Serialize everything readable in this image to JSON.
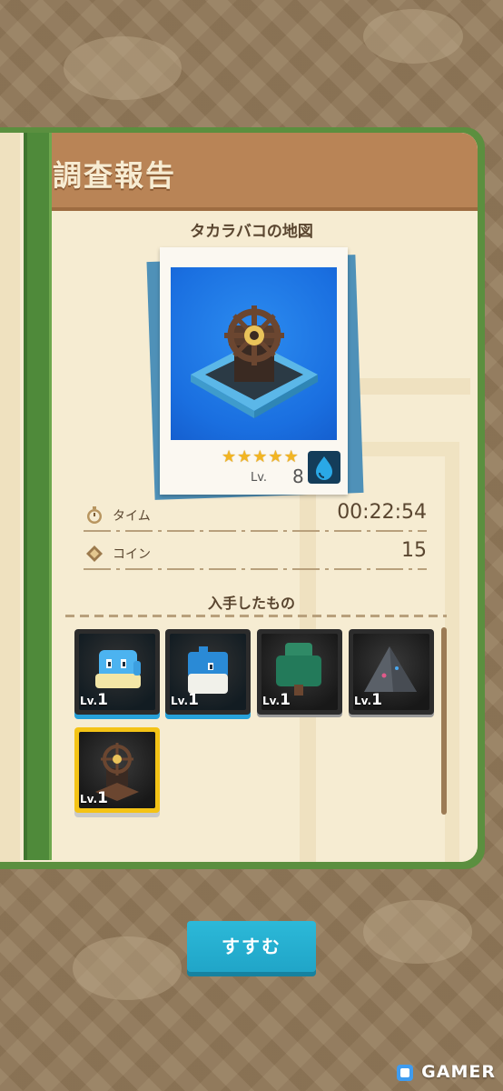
{
  "report": {
    "title": "調査報告",
    "map_name": "タカラバコの地図"
  },
  "card": {
    "stars": 5,
    "lv_label": "Lv.",
    "lv_value": "8",
    "element_icon": "water-drop-icon"
  },
  "stats": {
    "time_label": "タイム",
    "time_value": "00:22:54",
    "coin_label": "コイン",
    "coin_value": "15"
  },
  "obtained": {
    "title": "入手したもの",
    "items": [
      {
        "name": "blue-ghost-creature",
        "lv_prefix": "Lv.",
        "lv": "1"
      },
      {
        "name": "blue-bird-creature",
        "lv_prefix": "Lv.",
        "lv": "1"
      },
      {
        "name": "green-tree-creature",
        "lv_prefix": "Lv.",
        "lv": "1"
      },
      {
        "name": "grey-rock-creature",
        "lv_prefix": "Lv.",
        "lv": "1"
      },
      {
        "name": "treasure-map-item",
        "lv_prefix": "Lv.",
        "lv": "1"
      }
    ]
  },
  "buttons": {
    "proceed": "すすむ"
  },
  "watermark": "GAMER",
  "colors": {
    "header": "#b98456",
    "button": "#20a5c8",
    "star": "#f2b522",
    "book_green": "#5b8f3f"
  }
}
